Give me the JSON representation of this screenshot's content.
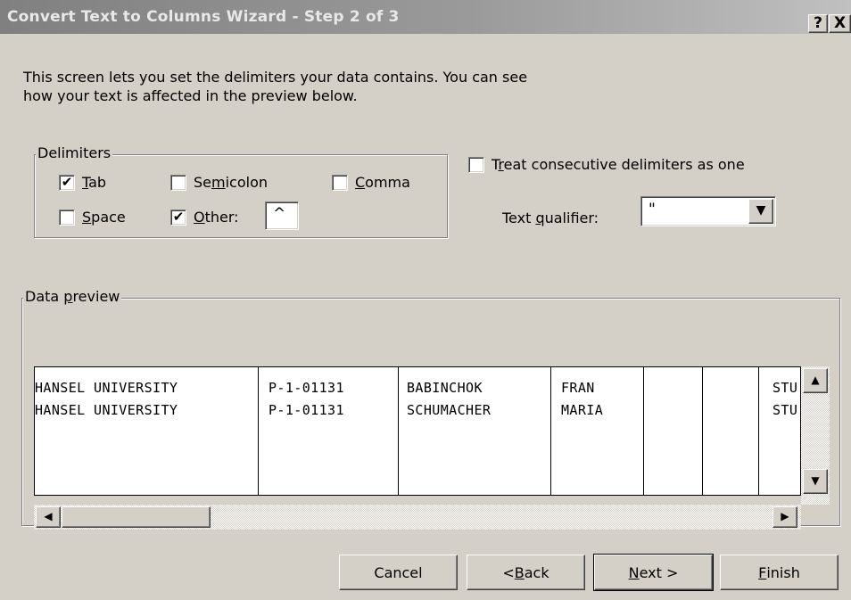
{
  "window": {
    "title": "Convert Text to Columns Wizard - Step 2 of 3",
    "help_label": "?",
    "close_label": "X"
  },
  "intro": {
    "line1": "This screen lets you set the delimiters your data contains.  You can see",
    "line2": "how your text is affected in the preview below."
  },
  "delimiters": {
    "group_label": "Delimiters",
    "tab": {
      "pre": "",
      "key": "T",
      "post": "ab",
      "checked": true
    },
    "semicolon": {
      "pre": "Se",
      "key": "m",
      "post": "icolon",
      "checked": false
    },
    "comma": {
      "pre": "",
      "key": "C",
      "post": "omma",
      "checked": false
    },
    "space": {
      "pre": "",
      "key": "S",
      "post": "pace",
      "checked": false
    },
    "other": {
      "pre": "",
      "key": "O",
      "post": "ther:",
      "checked": true,
      "value": "^"
    }
  },
  "options": {
    "consecutive": {
      "pre": "T",
      "key": "r",
      "post": "eat consecutive delimiters as one",
      "checked": false
    },
    "qualifier": {
      "pre": "Text ",
      "key": "q",
      "post": "ualifier:",
      "value": "\""
    }
  },
  "preview": {
    "label_pre": "Data ",
    "label_key": "p",
    "label_post": "review",
    "rows": [
      [
        "HANSEL UNIVERSITY",
        "P-1-01131",
        "BABINCHOK",
        "FRAN",
        "",
        "",
        "STU"
      ],
      [
        "HANSEL UNIVERSITY",
        "P-1-01131",
        "SCHUMACHER",
        "MARIA",
        "",
        "",
        "STU"
      ]
    ]
  },
  "buttons": {
    "cancel": "Cancel",
    "back": {
      "pre": "< ",
      "key": "B",
      "post": "ack"
    },
    "next": {
      "pre": "",
      "key": "N",
      "post": "ext >"
    },
    "finish": {
      "pre": "",
      "key": "F",
      "post": "inish"
    }
  },
  "glyphs": {
    "check": "✔",
    "dropdown_icon": "▼",
    "scroll_up_icon": "▲",
    "scroll_down_icon": "▼",
    "scroll_left_icon": "◀",
    "scroll_right_icon": "▶"
  }
}
